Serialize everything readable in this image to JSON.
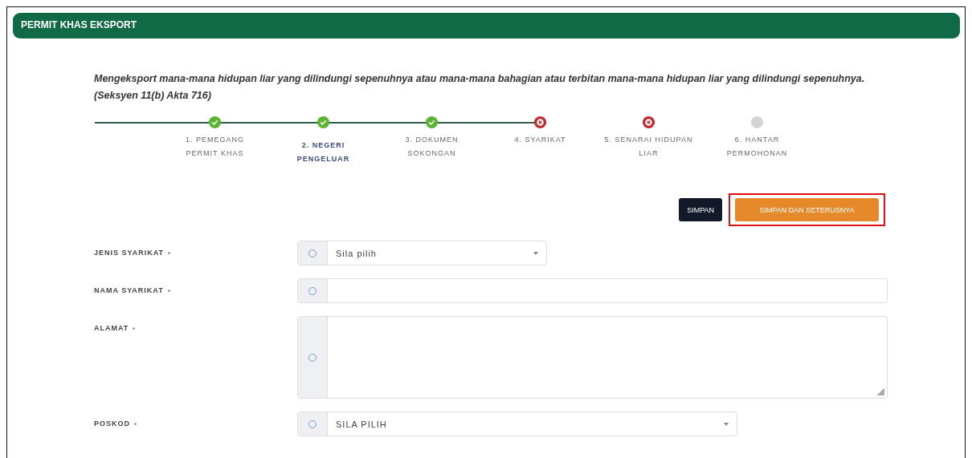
{
  "panel": {
    "title": "PERMIT KHAS EKSPORT"
  },
  "description": "Mengeksport mana-mana hidupan liar yang dilindungi sepenuhnya atau mana-mana bahagian atau terbitan mana-mana hidupan liar yang dilindungi sepenuhnya. (Seksyen 11(b) Akta 716)",
  "steps": [
    {
      "label": "1. PEMEGANG PERMIT KHAS",
      "kind": "done",
      "connected": true,
      "selected": false
    },
    {
      "label": "2. NEGERI PENGELUAR",
      "kind": "done",
      "connected": true,
      "selected": true
    },
    {
      "label": "3. DOKUMEN SOKONGAN",
      "kind": "done",
      "connected": true,
      "selected": false
    },
    {
      "label": "4. SYARIKAT",
      "kind": "error",
      "connected": true,
      "selected": false
    },
    {
      "label": "5. SENARAI HIDUPAN LIAR",
      "kind": "error",
      "connected": false,
      "selected": false
    },
    {
      "label": "6. HANTAR PERMOHONAN",
      "kind": "pending",
      "connected": false,
      "selected": false
    }
  ],
  "buttons": [
    {
      "label": "SIMPAN",
      "kind": "dark",
      "highlighted": false
    },
    {
      "label": "SIMPAN DAN SETERUSNYA",
      "kind": "orange",
      "highlighted": true
    }
  ],
  "fields": [
    {
      "label": "JENIS SYARIKAT",
      "required": true,
      "kind": "select",
      "value": "Sila pilih"
    },
    {
      "label": "NAMA SYARIKAT",
      "required": true,
      "kind": "text"
    },
    {
      "label": "ALAMAT",
      "required": true,
      "kind": "textarea"
    },
    {
      "label": "POSKOD",
      "required": true,
      "kind": "select",
      "value": "SILA PILIH"
    }
  ]
}
